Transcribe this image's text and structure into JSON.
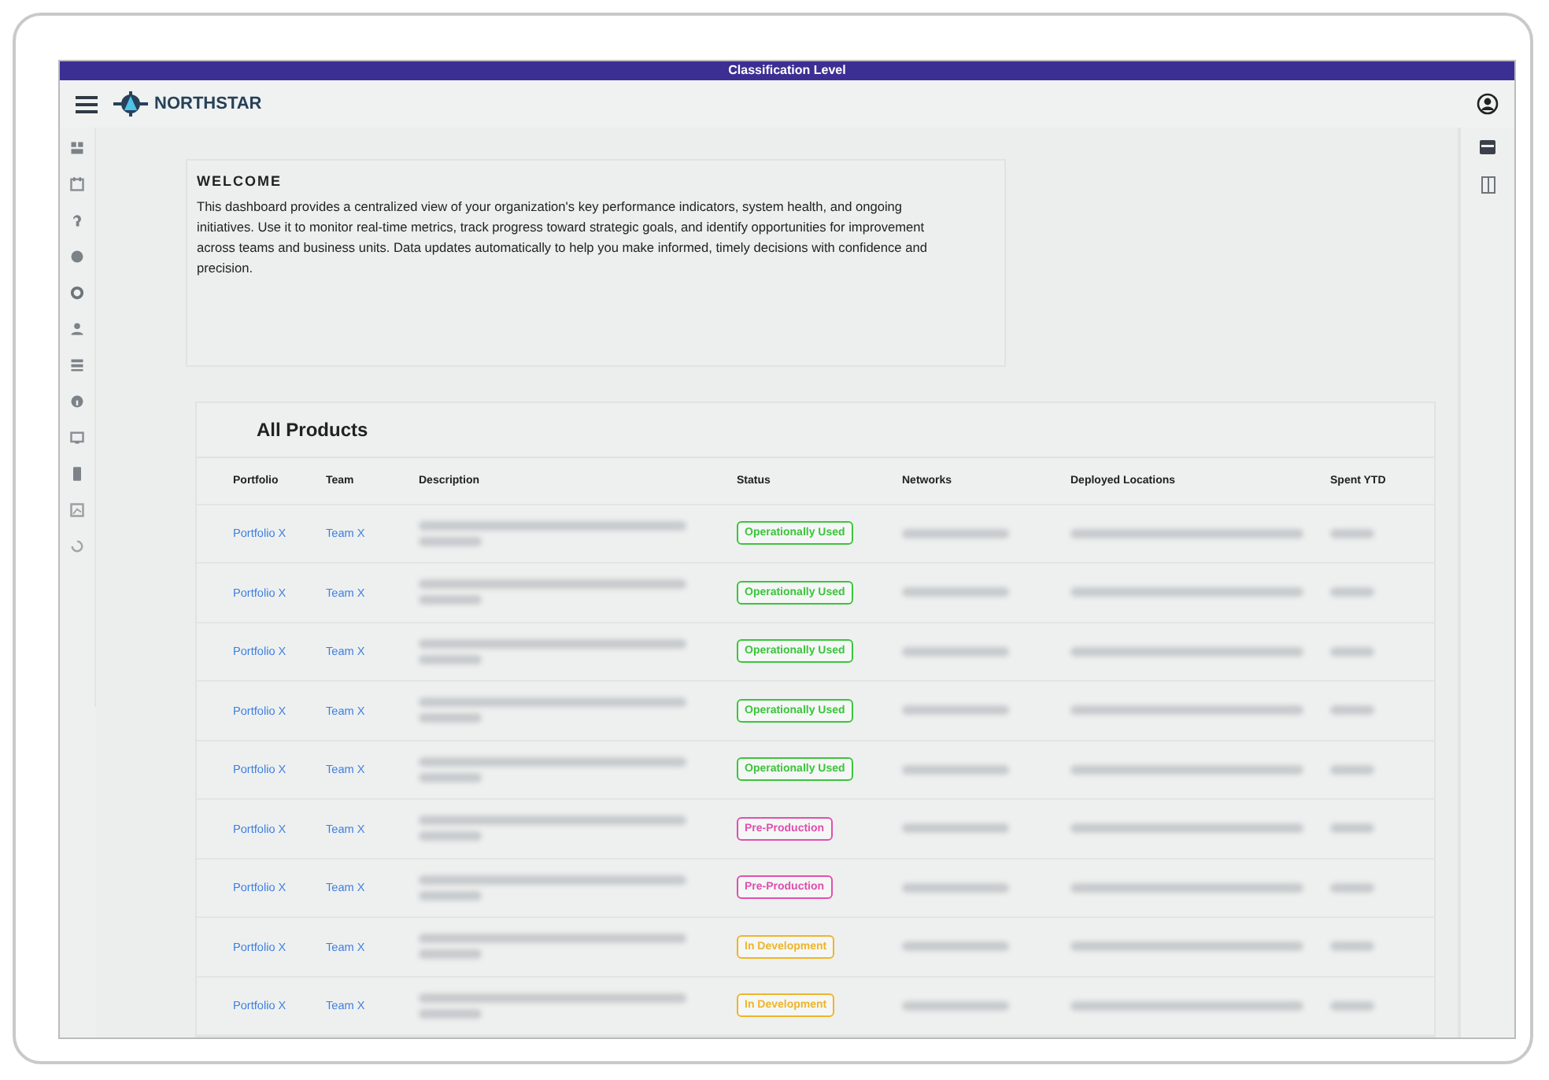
{
  "classification_bar": {
    "text": "Classification Level"
  },
  "header": {
    "brand": "NORTHSTAR"
  },
  "welcome": {
    "title": "WELCOME",
    "text": "This dashboard provides a centralized view of your organization's key performance indicators, system health, and ongoing initiatives. Use it to monitor real-time metrics, track progress toward strategic goals, and identify opportunities for improvement across teams and business units. Data updates automatically to help you make informed, timely decisions with confidence and precision."
  },
  "products": {
    "title": "All Products",
    "columns": [
      "Portfolio",
      "Team",
      "Description",
      "Status",
      "Networks",
      "Deployed Locations",
      "Spent YTD"
    ],
    "rows": [
      {
        "portfolio": "Portfolio X",
        "team": "Team X",
        "status": {
          "label": "Operationally Used",
          "color": "#3cc43c"
        }
      },
      {
        "portfolio": "Portfolio X",
        "team": "Team X",
        "status": {
          "label": "Operationally Used",
          "color": "#3cc43c"
        }
      },
      {
        "portfolio": "Portfolio X",
        "team": "Team X",
        "status": {
          "label": "Operationally Used",
          "color": "#3cc43c"
        }
      },
      {
        "portfolio": "Portfolio X",
        "team": "Team X",
        "status": {
          "label": "Operationally Used",
          "color": "#3cc43c"
        }
      },
      {
        "portfolio": "Portfolio X",
        "team": "Team X",
        "status": {
          "label": "Operationally Used",
          "color": "#3cc43c"
        }
      },
      {
        "portfolio": "Portfolio X",
        "team": "Team X",
        "status": {
          "label": "Pre-Production",
          "color": "#e04fb0"
        }
      },
      {
        "portfolio": "Portfolio X",
        "team": "Team X",
        "status": {
          "label": "Pre-Production",
          "color": "#e04fb0"
        }
      },
      {
        "portfolio": "Portfolio X",
        "team": "Team X",
        "status": {
          "label": "In Development",
          "color": "#f0b429"
        }
      },
      {
        "portfolio": "Portfolio X",
        "team": "Team X",
        "status": {
          "label": "In Development",
          "color": "#f0b429"
        }
      }
    ]
  }
}
